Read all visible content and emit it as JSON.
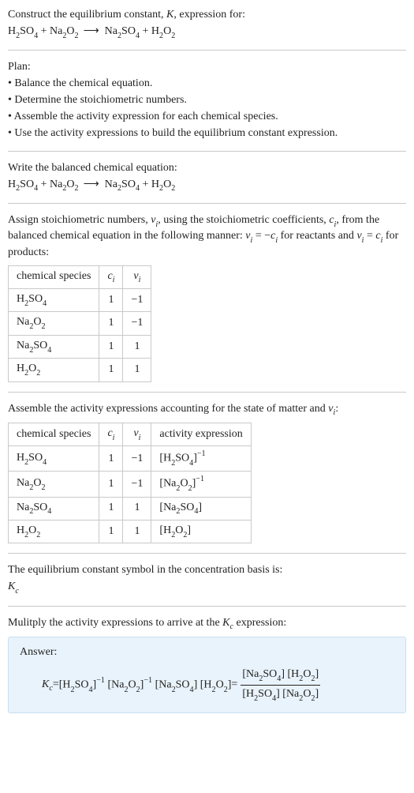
{
  "intro": {
    "line1_a": "Construct the equilibrium constant, ",
    "line1_b": ", expression for:",
    "K": "K"
  },
  "equation": {
    "lhs1": {
      "base": "H",
      "s1": "2",
      "mid": "SO",
      "s2": "4"
    },
    "plus": " + ",
    "lhs2": {
      "base": "Na",
      "s1": "2",
      "mid": "O",
      "s2": "2"
    },
    "arrow": "⟶",
    "rhs1": {
      "base": "Na",
      "s1": "2",
      "mid": "SO",
      "s2": "4"
    },
    "rhs2": {
      "base": "H",
      "s1": "2",
      "mid": "O",
      "s2": "2"
    }
  },
  "plan": {
    "title": "Plan:",
    "items": [
      "• Balance the chemical equation.",
      "• Determine the stoichiometric numbers.",
      "• Assemble the activity expression for each chemical species.",
      "• Use the activity expressions to build the equilibrium constant expression."
    ]
  },
  "balanced_label": "Write the balanced chemical equation:",
  "assign": {
    "part1": "Assign stoichiometric numbers, ",
    "nu_i": "ν",
    "sub_i": "i",
    "part2": ", using the stoichiometric coefficients, ",
    "c_i": "c",
    "part3": ", from the balanced chemical equation in the following manner: ",
    "eq1_lhs_v": "ν",
    "eq1_lhs_i": "i",
    "eq1_eq": " = −",
    "eq1_rhs_c": "c",
    "eq1_rhs_i": "i",
    "part4": " for reactants and ",
    "eq2_lhs_v": "ν",
    "eq2_lhs_i": "i",
    "eq2_eq": " = ",
    "eq2_rhs_c": "c",
    "eq2_rhs_i": "i",
    "part5": " for products:"
  },
  "table1": {
    "h1": "chemical species",
    "h2_c": "c",
    "h2_i": "i",
    "h3_v": "ν",
    "h3_i": "i",
    "rows": [
      {
        "c": "1",
        "v": "−1"
      },
      {
        "c": "1",
        "v": "−1"
      },
      {
        "c": "1",
        "v": "1"
      },
      {
        "c": "1",
        "v": "1"
      }
    ]
  },
  "assemble": {
    "part1": "Assemble the activity expressions accounting for the state of matter and ",
    "v": "ν",
    "i": "i",
    "part2": ":"
  },
  "table2": {
    "h1": "chemical species",
    "h2_c": "c",
    "h2_i": "i",
    "h3_v": "ν",
    "h3_i": "i",
    "h4": "activity expression",
    "rows": [
      {
        "c": "1",
        "v": "−1",
        "exp": "−1"
      },
      {
        "c": "1",
        "v": "−1",
        "exp": "−1"
      },
      {
        "c": "1",
        "v": "1",
        "exp": ""
      },
      {
        "c": "1",
        "v": "1",
        "exp": ""
      }
    ]
  },
  "basis": {
    "line1": "The equilibrium constant symbol in the concentration basis is:",
    "K": "K",
    "c": "c"
  },
  "mult": {
    "part1": "Mulitply the activity expressions to arrive at the ",
    "K": "K",
    "c": "c",
    "part2": " expression:"
  },
  "answer": {
    "label": "Answer:",
    "K": "K",
    "c": "c",
    "eq": " = ",
    "exp_neg1": "−1"
  }
}
